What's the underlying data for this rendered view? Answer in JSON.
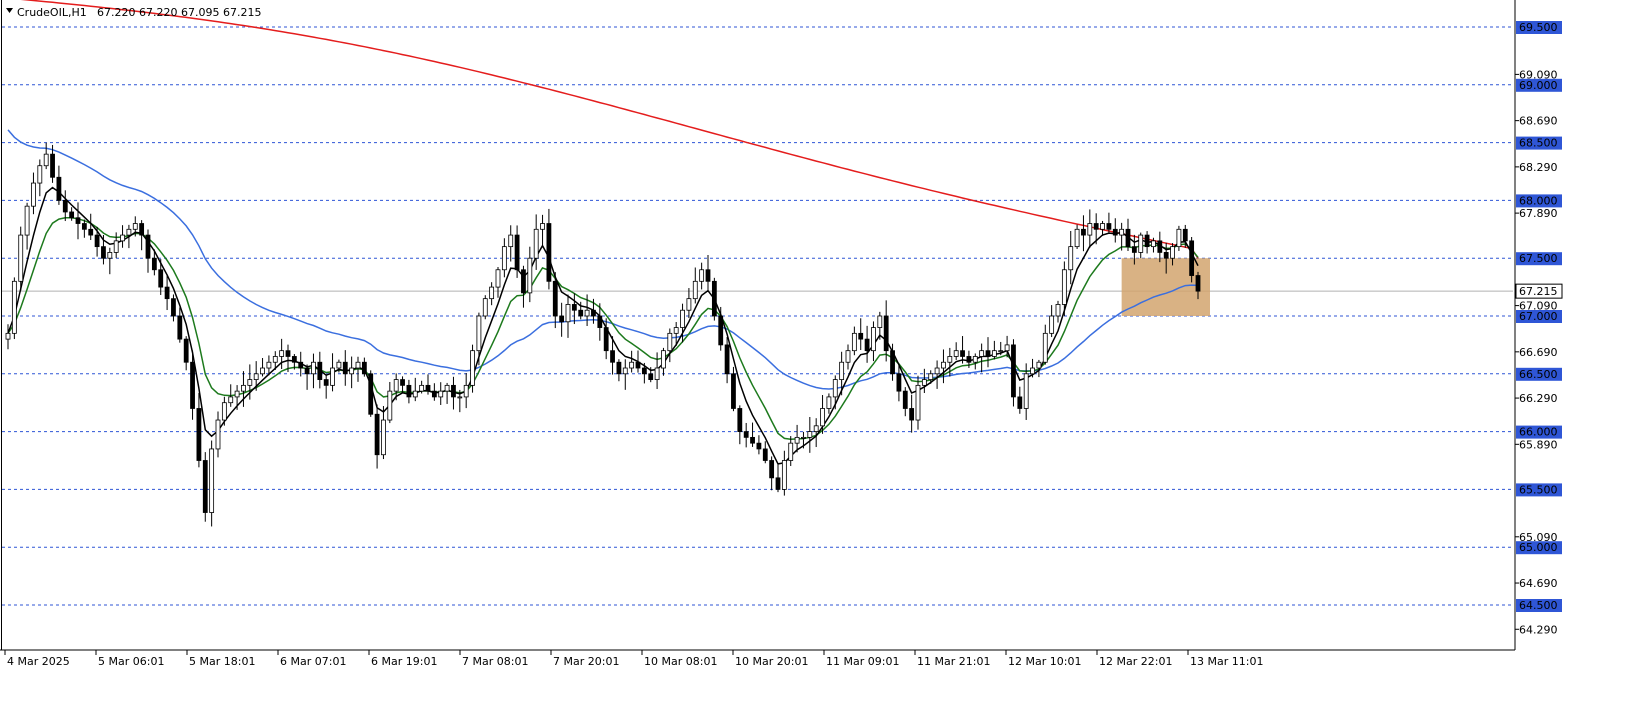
{
  "header": {
    "symbol": "CrudeOIL,H1",
    "ohlc": "67.220 67.220 67.095 67.215"
  },
  "colors": {
    "ma_red": "#e41d1d",
    "ma_blue": "#3b6fdf",
    "ma_green": "#1d7a1d",
    "ma_black": "#000000",
    "level_line": "#2f56d6",
    "zone_fill": "#d2a56f",
    "badge_bg": "#2f56d6"
  },
  "chart_data": {
    "type": "candlestick",
    "ylim": [
      64.1,
      69.7
    ],
    "price_ticks": [
      "69.090",
      "68.690",
      "68.290",
      "67.890",
      "67.090",
      "66.690",
      "66.290",
      "65.890",
      "65.090",
      "64.690",
      "64.290"
    ],
    "level_lines": [
      {
        "value": 69.5,
        "label": "69.500"
      },
      {
        "value": 69.0,
        "label": "69.000"
      },
      {
        "value": 68.5,
        "label": "68.500"
      },
      {
        "value": 68.0,
        "label": "68.000"
      },
      {
        "value": 67.5,
        "label": "67.500"
      },
      {
        "value": 67.0,
        "label": "67.000"
      },
      {
        "value": 66.5,
        "label": "66.500"
      },
      {
        "value": 66.0,
        "label": "66.000"
      },
      {
        "value": 65.5,
        "label": "65.500"
      },
      {
        "value": 65.0,
        "label": "65.000"
      },
      {
        "value": 64.5,
        "label": "64.500"
      }
    ],
    "current_price": {
      "value": 67.215,
      "label": "67.215"
    },
    "zone": {
      "from": 67.0,
      "to": 67.5
    },
    "x_labels": [
      "4 Mar 2025",
      "5 Mar 06:01",
      "5 Mar 18:01",
      "6 Mar 07:01",
      "6 Mar 19:01",
      "7 Mar 08:01",
      "7 Mar 20:01",
      "10 Mar 08:01",
      "10 Mar 20:01",
      "11 Mar 09:01",
      "11 Mar 21:01",
      "12 Mar 10:01",
      "12 Mar 22:01",
      "13 Mar 11:01"
    ],
    "closes": [
      66.85,
      67.3,
      67.7,
      67.95,
      68.15,
      68.3,
      68.4,
      68.2,
      68.0,
      67.9,
      67.85,
      67.8,
      67.75,
      67.7,
      67.6,
      67.5,
      67.55,
      67.65,
      67.7,
      67.75,
      67.8,
      67.7,
      67.5,
      67.4,
      67.25,
      67.15,
      67.0,
      66.8,
      66.6,
      66.2,
      65.75,
      65.3,
      65.85,
      66.1,
      66.25,
      66.3,
      66.35,
      66.4,
      66.45,
      66.5,
      66.55,
      66.6,
      66.65,
      66.7,
      66.65,
      66.6,
      66.55,
      66.5,
      66.6,
      66.45,
      66.4,
      66.55,
      66.6,
      66.5,
      66.55,
      66.6,
      66.5,
      66.15,
      65.8,
      66.1,
      66.35,
      66.45,
      66.4,
      66.3,
      66.35,
      66.4,
      66.35,
      66.3,
      66.35,
      66.4,
      66.3,
      66.3,
      66.4,
      66.7,
      67.0,
      67.15,
      67.25,
      67.4,
      67.6,
      67.7,
      67.4,
      67.2,
      67.5,
      67.75,
      67.8,
      67.3,
      67.0,
      66.95,
      67.1,
      67.05,
      67.0,
      67.05,
      67.0,
      66.9,
      66.7,
      66.6,
      66.5,
      66.55,
      66.6,
      66.55,
      66.5,
      66.45,
      66.55,
      66.7,
      66.85,
      66.9,
      67.05,
      67.15,
      67.3,
      67.4,
      67.3,
      67.0,
      66.75,
      66.5,
      66.2,
      66.0,
      65.95,
      65.9,
      65.85,
      65.75,
      65.6,
      65.5,
      65.75,
      65.9,
      65.95,
      65.95,
      66.0,
      66.05,
      66.2,
      66.3,
      66.45,
      66.6,
      66.7,
      66.85,
      66.8,
      66.7,
      66.9,
      67.0,
      66.7,
      66.5,
      66.35,
      66.2,
      66.1,
      66.4,
      66.45,
      66.5,
      66.55,
      66.6,
      66.65,
      66.7,
      66.65,
      66.6,
      66.65,
      66.7,
      66.65,
      66.7,
      66.7,
      66.75,
      66.3,
      66.2,
      66.5,
      66.55,
      66.6,
      66.85,
      67.0,
      67.1,
      67.4,
      67.6,
      67.75,
      67.7,
      67.8,
      67.75,
      67.8,
      67.75,
      67.7,
      67.75,
      67.6,
      67.55,
      67.7,
      67.6,
      67.65,
      67.55,
      67.5,
      67.6,
      67.75,
      67.65,
      67.35,
      67.215
    ]
  }
}
